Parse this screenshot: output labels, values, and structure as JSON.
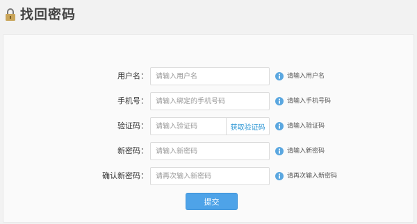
{
  "page": {
    "title": "找回密码"
  },
  "form": {
    "username": {
      "label": "用户名：",
      "placeholder": "请输入用户名",
      "hint": "请输入用户名"
    },
    "phone": {
      "label": "手机号：",
      "placeholder": "请输入绑定的手机号码",
      "hint": "请输入手机号码"
    },
    "code": {
      "label": "验证码：",
      "placeholder": "请输入验证码",
      "button": "获取验证码",
      "hint": "请输入验证码"
    },
    "new_password": {
      "label": "新密码：",
      "placeholder": "请输入新密码",
      "hint": "请输入新密码"
    },
    "confirm_password": {
      "label": "确认新密码：",
      "placeholder": "请再次输入新密码",
      "hint": "请再次输入新密码"
    },
    "submit": "提交"
  },
  "colors": {
    "accent": "#4ea3e8",
    "link": "#2c96d4",
    "info_icon": "#5aa7e0"
  },
  "icons": {
    "title": "lock-icon",
    "hint": "info-icon"
  }
}
